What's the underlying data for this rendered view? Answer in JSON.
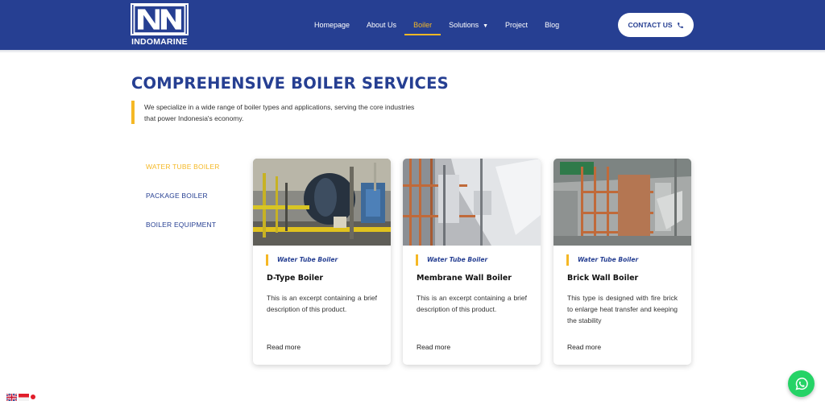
{
  "brand": {
    "name": "INDOMARINE",
    "color": "#263f92",
    "accent": "#f5b825"
  },
  "nav": {
    "items": [
      {
        "label": "Homepage"
      },
      {
        "label": "About Us"
      },
      {
        "label": "Boiler",
        "active": true
      },
      {
        "label": "Solutions",
        "has_dropdown": true
      },
      {
        "label": "Project"
      },
      {
        "label": "Blog"
      }
    ],
    "contact_label": "CONTACT US",
    "contact_icon": "phone-icon"
  },
  "hero": {
    "title": "COMPREHENSIVE BOILER SERVICES",
    "intro": "We specialize in a wide range of boiler types and applications, serving the core industries that power Indonesia's economy."
  },
  "sidebar": {
    "items": [
      {
        "label": "WATER TUBE BOILER",
        "active": true
      },
      {
        "label": "PACKAGE BOILER"
      },
      {
        "label": "BOILER EQUIPMENT"
      }
    ]
  },
  "cards": [
    {
      "category": "Water Tube Boiler",
      "title": "D-Type Boiler",
      "description": "This is an excerpt containing a brief description of this product.",
      "link": "Read more"
    },
    {
      "category": "Water Tube Boiler",
      "title": "Membrane Wall Boiler",
      "description": "This is an excerpt containing a brief description of this product.",
      "link": "Read more"
    },
    {
      "category": "Water Tube Boiler",
      "title": "Brick Wall Boiler",
      "description": "This type is designed with fire brick to enlarge heat transfer and keeping the stability",
      "link": "Read more"
    }
  ],
  "floating": {
    "chat_icon": "whatsapp-icon",
    "language_icons": [
      "uk-flag-icon",
      "indonesia-flag-icon"
    ]
  }
}
